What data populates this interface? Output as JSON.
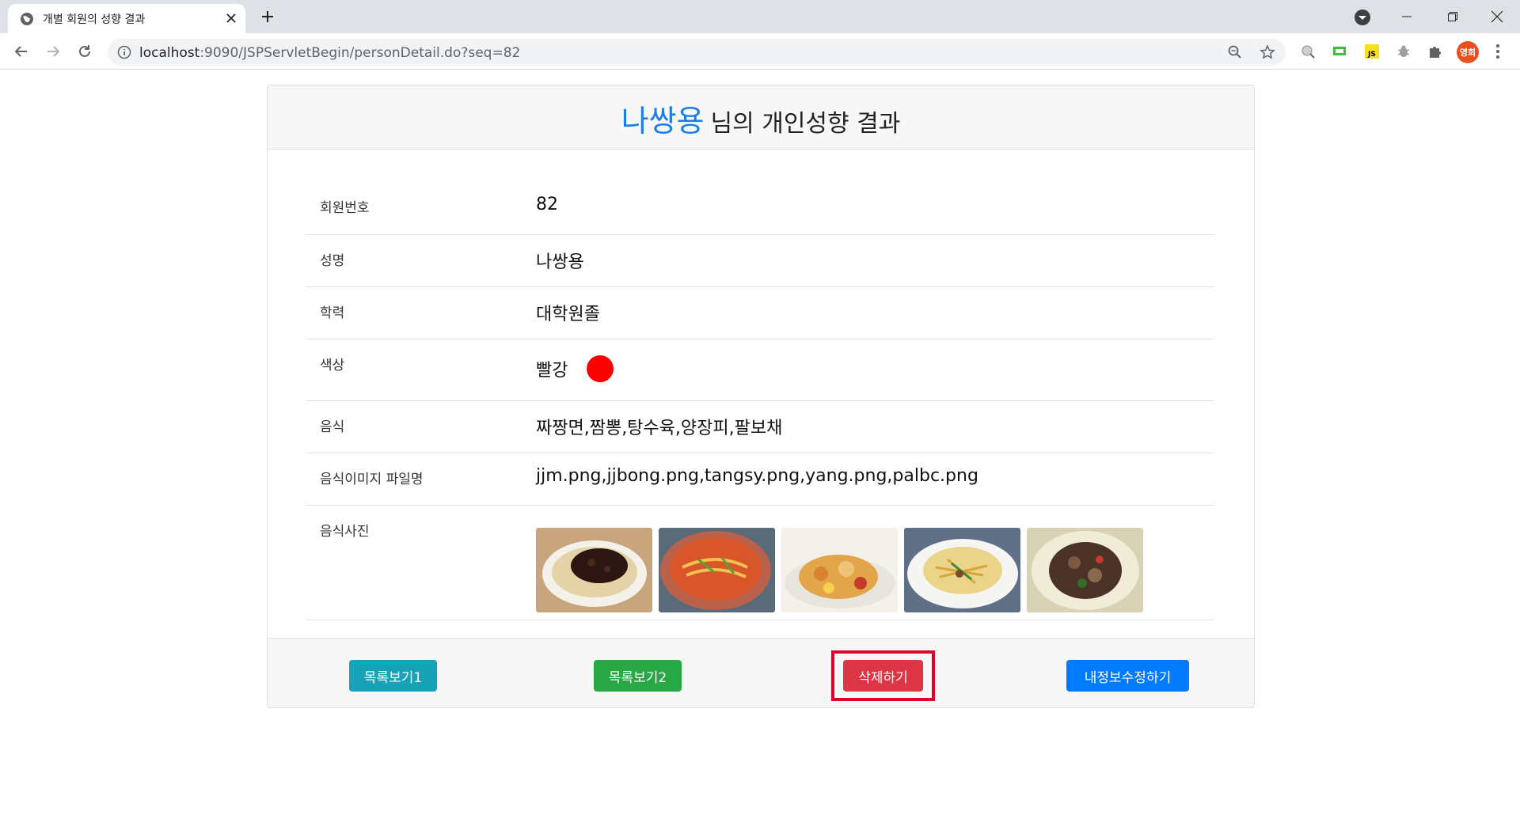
{
  "browser": {
    "tab_title": "개별 회원의 성향 결과",
    "url_host": "localhost",
    "url_rest": ":9090/JSPServletBegin/personDetail.do?seq=82",
    "profile_initials": "영희",
    "ext_js_label": "JS"
  },
  "page": {
    "header_name": "나쌍용",
    "header_suffix": "님의 개인성향 결과",
    "rows": [
      {
        "label": "회원번호",
        "value": "82"
      },
      {
        "label": "성명",
        "value": "나쌍용"
      },
      {
        "label": "학력",
        "value": "대학원졸"
      },
      {
        "label": "색상",
        "value": "빨강",
        "color": "#ff0000"
      },
      {
        "label": "음식",
        "value": "짜짱면,짬뽕,탕수육,양장피,팔보채"
      },
      {
        "label": "음식이미지 파일명",
        "value": "jjm.png,jjbong.png,tangsy.png,yang.png,palbc.png"
      },
      {
        "label": "음식사진",
        "images": [
          "jjm.png",
          "jjbong.png",
          "tangsy.png",
          "yang.png",
          "palbc.png"
        ]
      }
    ],
    "buttons": {
      "list1": "목록보기1",
      "list2": "목록보기2",
      "delete": "삭제하기",
      "edit": "내정보수정하기"
    },
    "colors": {
      "accent_name": "#1a7ee6",
      "btn_info": "#17a2b8",
      "btn_success": "#28a745",
      "btn_danger": "#dc3545",
      "btn_primary": "#007bff",
      "highlight": "#e0002a"
    }
  }
}
